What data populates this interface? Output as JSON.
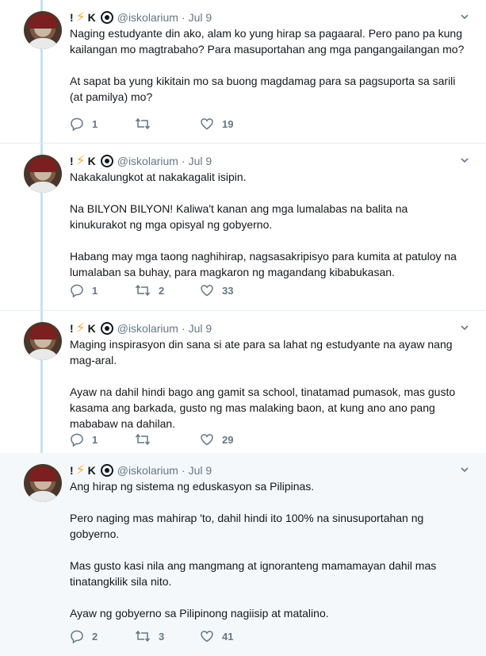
{
  "tweets": [
    {
      "name_mark": "!",
      "name_letter": "K",
      "handle": "@iskolarium",
      "dot": "·",
      "date": "Jul 9",
      "paragraphs": [
        "Naging estudyante din ako, alam ko yung hirap sa pagaaral. Pero pano pa kung kailangan mo magtrabaho? Para masuportahan ang mga pangangailangan mo?",
        "At sapat ba yung kikitain mo sa buong magdamag para sa pagsuporta sa sarili (at pamilya) mo?"
      ],
      "replies": "1",
      "retweets": "",
      "likes": "19"
    },
    {
      "name_mark": "!",
      "name_letter": "K",
      "handle": "@iskolarium",
      "dot": "·",
      "date": "Jul 9",
      "paragraphs": [
        "Nakakalungkot at nakakagalit isipin.",
        "Na BILYON BILYON! Kaliwa't kanan ang mga lumalabas na balita na kinukurakot ng mga opisyal ng gobyerno.",
        "Habang may mga taong naghihirap, nagsasakripisyo para kumita at patuloy na lumalaban sa buhay, para magkaron ng magandang kibabukasan."
      ],
      "replies": "1",
      "retweets": "2",
      "likes": "33"
    },
    {
      "name_mark": "!",
      "name_letter": "K",
      "handle": "@iskolarium",
      "dot": "·",
      "date": "Jul 9",
      "paragraphs": [
        "Maging inspirasyon din sana si ate para sa lahat ng estudyante na ayaw nang mag-aral.",
        "Ayaw na dahil hindi bago ang gamit sa school, tinatamad pumasok, mas gusto kasama ang barkada, gusto ng mas malaking baon, at kung ano ano pang mababaw na dahilan."
      ],
      "replies": "1",
      "retweets": "",
      "likes": "29"
    },
    {
      "name_mark": "!",
      "name_letter": "K",
      "handle": "@iskolarium",
      "dot": "·",
      "date": "Jul 9",
      "paragraphs": [
        "Ang hirap ng sistema ng eduskasyon sa Pilipinas.",
        "Pero naging mas mahirap 'to, dahil hindi ito 100% na sinusuportahan ng gobyerno.",
        "Mas gusto kasi nila ang mangmang at ignoranteng mamamayan dahil mas tinatangkilik sila nito.",
        "Ayaw ng gobyerno sa Pilipinong nagiisip at matalino."
      ],
      "replies": "2",
      "retweets": "3",
      "likes": "41"
    }
  ],
  "icons": {
    "name_emoji": "lightning-bolt-icon",
    "badge": "eye-icon",
    "more": "chevron-down-icon",
    "reply": "reply-icon",
    "retweet": "retweet-icon",
    "like": "heart-icon"
  },
  "colors": {
    "thread_line": "#c4e1f3",
    "secondary_text": "#657786",
    "highlight_bg": "#f5f8fa",
    "bolt": "#ffac33"
  }
}
